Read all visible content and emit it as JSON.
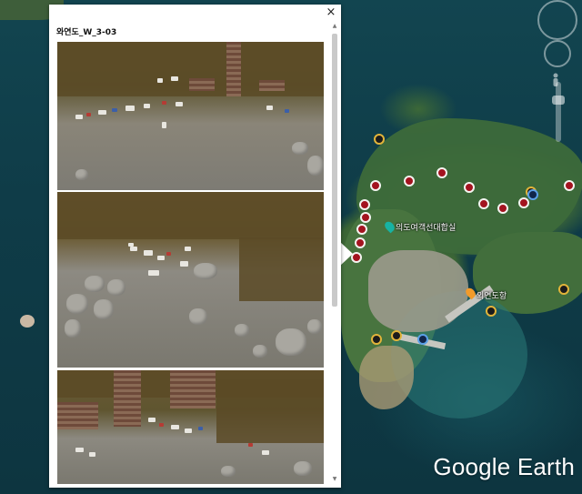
{
  "popup": {
    "title": "와연도_W_3-03",
    "close_glyph": "×",
    "scroll_up_glyph": "▲",
    "scroll_down_glyph": "▼",
    "images": [
      {
        "name": "aerial-photo-1"
      },
      {
        "name": "aerial-photo-2"
      },
      {
        "name": "aerial-photo-3"
      }
    ]
  },
  "map": {
    "place_labels": [
      "의도여객선대합실",
      "외연도항"
    ],
    "markers": {
      "red": 13,
      "yellow": 6,
      "blue": 2
    },
    "watermark": "Google Earth",
    "colors": {
      "marker_red": "#a3131f",
      "marker_yellow": "#e2b43a",
      "marker_blue": "#5aa0e8",
      "water": "#0f3c48",
      "land": "#3d6a3a"
    }
  }
}
